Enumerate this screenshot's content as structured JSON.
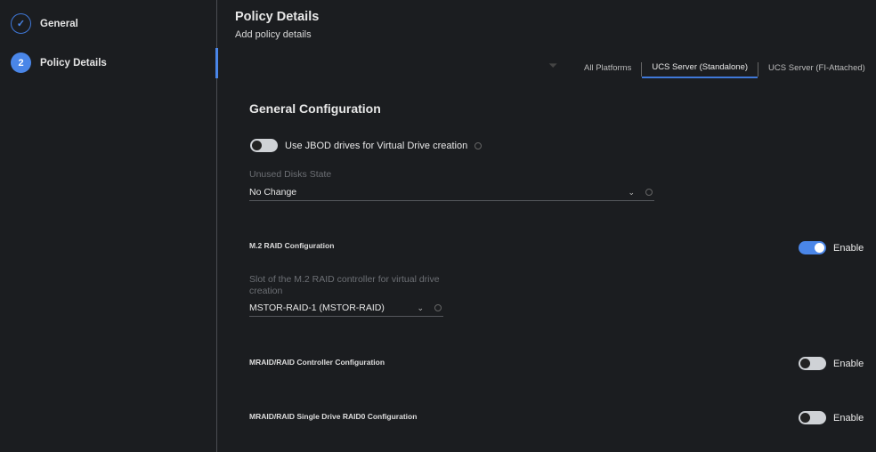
{
  "sidebar": {
    "steps": [
      {
        "number": "",
        "label": "General",
        "state": "completed"
      },
      {
        "number": "2",
        "label": "Policy Details",
        "state": "active"
      }
    ]
  },
  "header": {
    "title": "Policy Details",
    "subtitle": "Add policy details"
  },
  "tabs": [
    "All Platforms",
    "UCS Server (Standalone)",
    "UCS Server (FI-Attached)"
  ],
  "active_tab": "UCS Server (Standalone)",
  "general": {
    "section_title": "General Configuration",
    "jbod_label": "Use JBOD drives for Virtual Drive creation",
    "jbod_on": false,
    "unused_disks_label": "Unused Disks State",
    "unused_disks_value": "No Change"
  },
  "m2": {
    "title": "M.2 RAID Configuration",
    "enable_label": "Enable",
    "on": true,
    "slot_label": "Slot of the M.2 RAID controller for virtual drive creation",
    "slot_value": "MSTOR-RAID-1 (MSTOR-RAID)"
  },
  "mraid": {
    "title": "MRAID/RAID Controller Configuration",
    "enable_label": "Enable",
    "on": false
  },
  "raid0": {
    "title": "MRAID/RAID Single Drive RAID0 Configuration",
    "enable_label": "Enable",
    "on": false
  },
  "colors": {
    "accent": "#4a86e8",
    "background": "#1b1d20"
  }
}
